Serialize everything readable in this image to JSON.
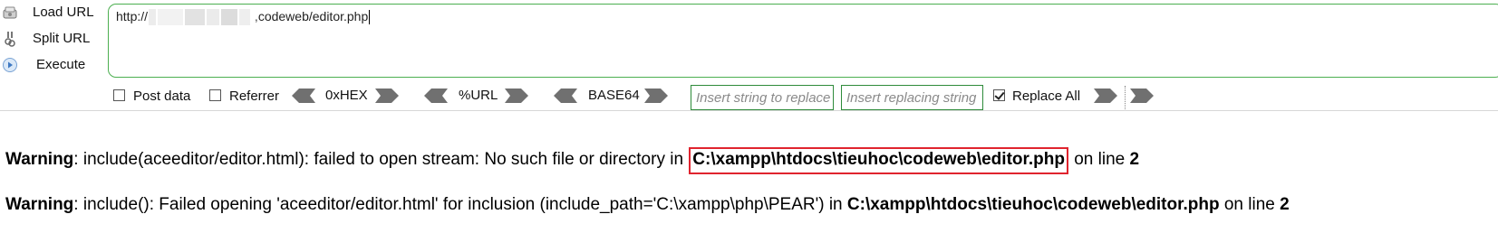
{
  "actions": [
    {
      "label": "Load URL",
      "icon": "load-url-icon"
    },
    {
      "label": "Split URL",
      "icon": "split-url-icon"
    },
    {
      "label": "Execute",
      "icon": "execute-icon"
    }
  ],
  "url": {
    "prefix": "http://",
    "suffix": "codeweb/editor.php"
  },
  "options": {
    "post_data": {
      "label": "Post data",
      "checked": false
    },
    "referrer": {
      "label": "Referrer",
      "checked": false
    },
    "encoders": [
      "0xHEX",
      "%URL",
      "BASE64"
    ],
    "replace_search_placeholder": "Insert string to replace",
    "replace_with_placeholder": "Insert replacing string",
    "replace_all": {
      "label": "Replace All",
      "checked": true
    }
  },
  "messages": [
    {
      "level": "Warning",
      "text": ": include(aceeditor/editor.html): failed to open stream: No such file or directory in ",
      "path": "C:\\xampp\\htdocs\\tieuhoc\\codeweb\\editor.php",
      "line_label": " on line ",
      "line": "2"
    },
    {
      "level": "Warning",
      "text": ": include(): Failed opening 'aceeditor/editor.html' for inclusion (include_path='C:\\xampp\\php\\PEAR') in ",
      "path": "C:\\xampp\\htdocs\\tieuhoc\\codeweb\\editor.php",
      "line_label": " on line ",
      "line": "2"
    }
  ],
  "colors": {
    "accent_green": "#4caf50",
    "highlight_red": "#e0242e",
    "arrow_gray": "#707070"
  }
}
